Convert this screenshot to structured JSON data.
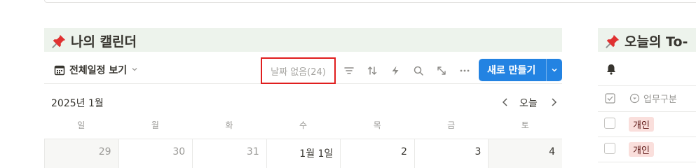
{
  "calendar": {
    "title": "나의 캘린더",
    "view_label": "전체일정 보기",
    "no_date_label": "날짜 없음(24)",
    "new_button_label": "새로 만들기",
    "month_label": "2025년 1월",
    "today_label": "오늘",
    "weekdays": [
      "일",
      "월",
      "화",
      "수",
      "목",
      "금",
      "토"
    ],
    "days": [
      "29",
      "30",
      "31",
      "1월 1일",
      "2",
      "3",
      "4"
    ],
    "colors": {
      "accent": "#2383e2",
      "header_bg": "#edf3ec",
      "highlight": "#e01e1e"
    }
  },
  "todo": {
    "title": "오늘의 To-",
    "column_header": "업무구분",
    "rows": [
      {
        "tag": "개인"
      },
      {
        "tag": "개인"
      }
    ],
    "tag_color": "#fadfdc"
  },
  "icons": [
    "pin-icon",
    "calendar-view-icon",
    "filter-icon",
    "sort-icon",
    "automation-icon",
    "search-icon",
    "expand-icon",
    "more-icon",
    "bell-icon",
    "checkbox-icon",
    "select-icon"
  ]
}
